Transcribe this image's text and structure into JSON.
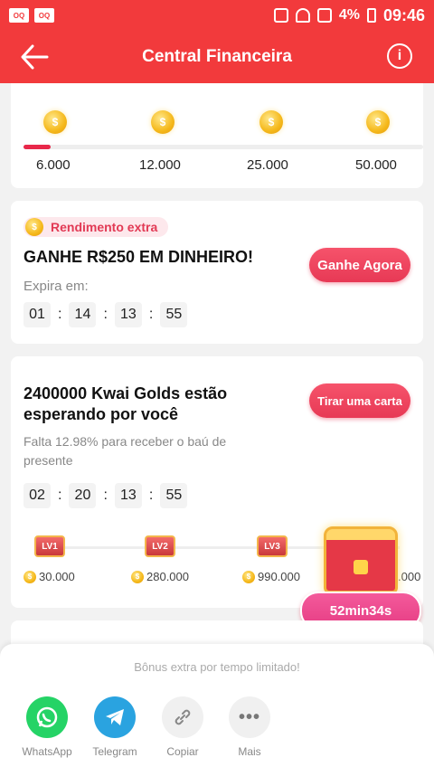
{
  "status_bar": {
    "battery": "4%",
    "time": "09:46"
  },
  "header": {
    "title": "Central Financeira"
  },
  "milestones": [
    "6.000",
    "12.000",
    "25.000",
    "50.000"
  ],
  "extra_card": {
    "badge": "Rendimento extra",
    "headline": "GANHE R$250 EM DINHEIRO!",
    "button": "Ganhe Agora",
    "expires_label": "Expira em:",
    "timer": [
      "01",
      "14",
      "13",
      "55"
    ]
  },
  "golds_card": {
    "headline_line1": "2400000 Kwai Golds estão",
    "headline_line2": "esperando por você",
    "button": "Tirar uma carta",
    "progress_line1": "Falta 12.98% para receber o baú de",
    "progress_line2": "presente",
    "timer": [
      "02",
      "20",
      "13",
      "55"
    ],
    "levels": [
      {
        "lv": "LV1",
        "amount": "30.000"
      },
      {
        "lv": "LV2",
        "amount": "280.000"
      },
      {
        "lv": "LV3",
        "amount": "990.000"
      },
      {
        "lv": "",
        "amount": ".000"
      }
    ]
  },
  "floating_timer": "52min34s",
  "share": {
    "title": "Bônus extra por tempo limitado!",
    "items": [
      {
        "label": "WhatsApp",
        "color": "#25d366"
      },
      {
        "label": "Telegram",
        "color": "#2aa3e0"
      },
      {
        "label": "Copiar",
        "color": "#f0f0f0"
      },
      {
        "label": "Mais",
        "color": "#f0f0f0"
      }
    ]
  }
}
